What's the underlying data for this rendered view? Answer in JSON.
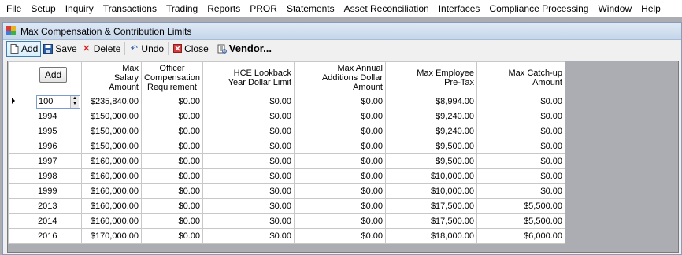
{
  "menu": [
    "File",
    "Setup",
    "Inquiry",
    "Transactions",
    "Trading",
    "Reports",
    "PROR",
    "Statements",
    "Asset Reconciliation",
    "Interfaces",
    "Compliance Processing",
    "Window",
    "Help"
  ],
  "window": {
    "title": "Max Compensation & Contribution Limits"
  },
  "toolbar": {
    "add": "Add",
    "save": "Save",
    "delete": "Delete",
    "undo": "Undo",
    "close": "Close",
    "vendor": "Vendor..."
  },
  "tooltip": "Add",
  "columns": [
    {
      "label": "Max\nSalary\nAmount"
    },
    {
      "label": "Officer\nCompensation\nRequirement"
    },
    {
      "label": "HCE Lookback\nYear Dollar Limit"
    },
    {
      "label": "Max Annual\nAdditions Dollar\nAmount"
    },
    {
      "label": "Max Employee\nPre-Tax"
    },
    {
      "label": "Max Catch-up\nAmount"
    }
  ],
  "rows": [
    {
      "year": "100",
      "vals": [
        "$235,840.00",
        "$0.00",
        "$0.00",
        "$0.00",
        "$8,994.00",
        "$0.00"
      ]
    },
    {
      "year": "1994",
      "vals": [
        "$150,000.00",
        "$0.00",
        "$0.00",
        "$0.00",
        "$9,240.00",
        "$0.00"
      ]
    },
    {
      "year": "1995",
      "vals": [
        "$150,000.00",
        "$0.00",
        "$0.00",
        "$0.00",
        "$9,240.00",
        "$0.00"
      ]
    },
    {
      "year": "1996",
      "vals": [
        "$150,000.00",
        "$0.00",
        "$0.00",
        "$0.00",
        "$9,500.00",
        "$0.00"
      ]
    },
    {
      "year": "1997",
      "vals": [
        "$160,000.00",
        "$0.00",
        "$0.00",
        "$0.00",
        "$9,500.00",
        "$0.00"
      ]
    },
    {
      "year": "1998",
      "vals": [
        "$160,000.00",
        "$0.00",
        "$0.00",
        "$0.00",
        "$10,000.00",
        "$0.00"
      ]
    },
    {
      "year": "1999",
      "vals": [
        "$160,000.00",
        "$0.00",
        "$0.00",
        "$0.00",
        "$10,000.00",
        "$0.00"
      ]
    },
    {
      "year": "2013",
      "vals": [
        "$160,000.00",
        "$0.00",
        "$0.00",
        "$0.00",
        "$17,500.00",
        "$5,500.00"
      ]
    },
    {
      "year": "2014",
      "vals": [
        "$160,000.00",
        "$0.00",
        "$0.00",
        "$0.00",
        "$17,500.00",
        "$5,500.00"
      ]
    },
    {
      "year": "2016",
      "vals": [
        "$170,000.00",
        "$0.00",
        "$0.00",
        "$0.00",
        "$18,000.00",
        "$6,000.00"
      ]
    }
  ]
}
